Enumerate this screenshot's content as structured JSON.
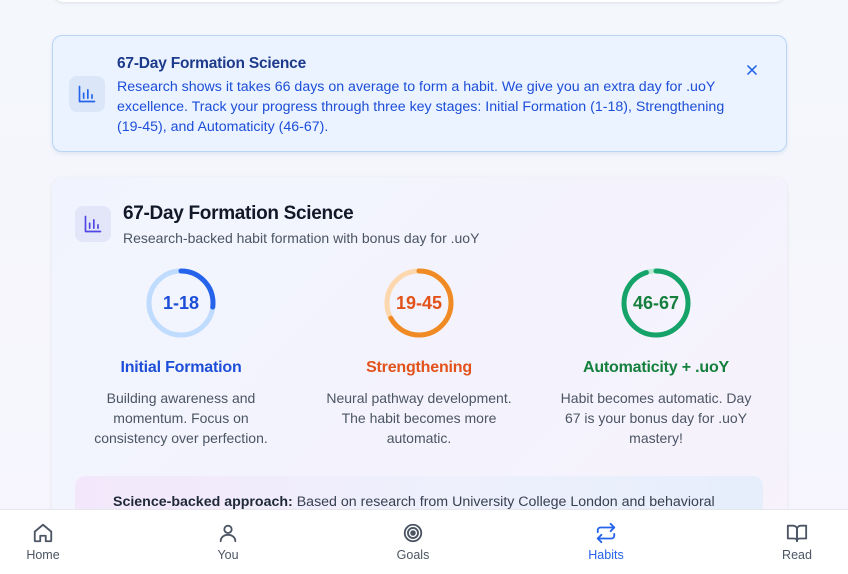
{
  "banner": {
    "title": "67-Day Formation Science",
    "text": "Research shows it takes 66 days on average to form a habit. We give you an extra day for .uoY excellence. Track your progress through three key stages: Initial Formation (1-18), Strengthening (19-45), and Automaticity (46-67).",
    "icon": "bar-chart-icon",
    "close_icon": "close-icon"
  },
  "science": {
    "title": "67-Day Formation Science",
    "subtitle": "Research-backed habit formation with bonus day for .uoY",
    "icon": "bar-chart-icon",
    "stages": [
      {
        "range": "1-18",
        "name": "Initial Formation",
        "description": "Building awareness and momentum. Focus on consistency over perfection.",
        "color": "#2563eb",
        "track_color": "#bfdbfe",
        "name_color": "#1d4ed8",
        "progress": 0.27
      },
      {
        "range": "19-45",
        "name": "Strengthening",
        "description": "Neural pathway development. The habit becomes more automatic.",
        "color": "#f08a24",
        "track_color": "#fdd7ad",
        "name_color": "#e2521b",
        "progress": 0.67
      },
      {
        "range": "46-67",
        "name": "Automaticity + .uoY",
        "description": "Habit becomes automatic. Day 67 is your bonus day for .uoY mastery!",
        "color": "#16a36a",
        "track_color": "#b7ecd3",
        "name_color": "#15803d",
        "progress": 0.95
      }
    ],
    "note": {
      "bold": "Science-backed approach:",
      "text": " Based on research from University College London and behavioral"
    }
  },
  "nav": {
    "active": "Habits",
    "accent": "#2563eb",
    "items": [
      {
        "label": "Home",
        "icon": "home-icon"
      },
      {
        "label": "You",
        "icon": "user-icon"
      },
      {
        "label": "Goals",
        "icon": "target-icon"
      },
      {
        "label": "Habits",
        "icon": "repeat-icon"
      },
      {
        "label": "Read",
        "icon": "book-icon"
      }
    ]
  }
}
